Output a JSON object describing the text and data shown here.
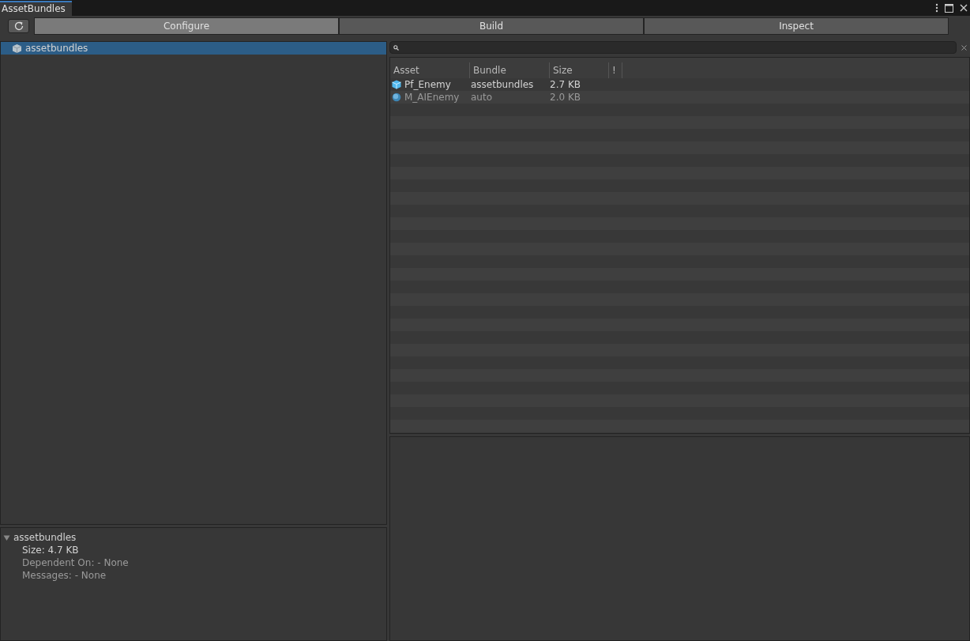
{
  "window": {
    "title": "AssetBundles"
  },
  "tabs": [
    {
      "label": "Configure",
      "selected": true
    },
    {
      "label": "Build",
      "selected": false
    },
    {
      "label": "Inspect",
      "selected": false
    }
  ],
  "bundle_tree": {
    "items": [
      {
        "label": "assetbundles",
        "selected": true
      }
    ]
  },
  "bundle_details": {
    "title": "assetbundles",
    "expanded": true,
    "lines": [
      {
        "text": "Size: 4.7 KB",
        "dimmed": false
      },
      {
        "text": "Dependent On: - None",
        "dimmed": true
      },
      {
        "text": "Messages: - None",
        "dimmed": true
      }
    ]
  },
  "asset_table": {
    "columns": [
      "Asset",
      "Bundle",
      "Size",
      "!"
    ],
    "rows": [
      {
        "kind": "prefab",
        "asset": "Pf_Enemy",
        "bundle": "assetbundles",
        "size": "2.7 KB",
        "dimmed": false
      },
      {
        "kind": "material",
        "asset": "M_AIEnemy",
        "bundle": "auto",
        "size": "2.0 KB",
        "dimmed": true
      }
    ]
  }
}
